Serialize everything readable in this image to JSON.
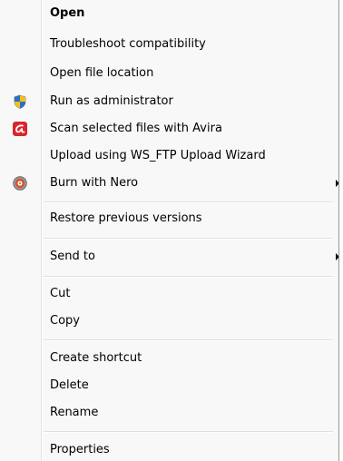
{
  "menu": {
    "items": [
      {
        "label": "Open"
      },
      {
        "label": "Troubleshoot compatibility"
      },
      {
        "label": "Open file location"
      },
      {
        "label": "Run as administrator",
        "icon": "uac-shield-icon"
      },
      {
        "label": "Scan selected files with Avira",
        "icon": "avira-icon"
      },
      {
        "label": "Upload using WS_FTP Upload Wizard"
      },
      {
        "label": "Burn with Nero",
        "icon": "nero-icon"
      },
      {
        "label": "Restore previous versions"
      },
      {
        "label": "Send to"
      },
      {
        "label": "Cut"
      },
      {
        "label": "Copy"
      },
      {
        "label": "Create shortcut"
      },
      {
        "label": "Delete"
      },
      {
        "label": "Rename"
      },
      {
        "label": "Properties"
      }
    ]
  },
  "colors": {
    "menu_background": "#f8f8f8",
    "avira_red": "#e3222b",
    "uac_blue": "#2f6fc6",
    "uac_yellow": "#f2c315",
    "nero_orange": "#d9532a"
  }
}
